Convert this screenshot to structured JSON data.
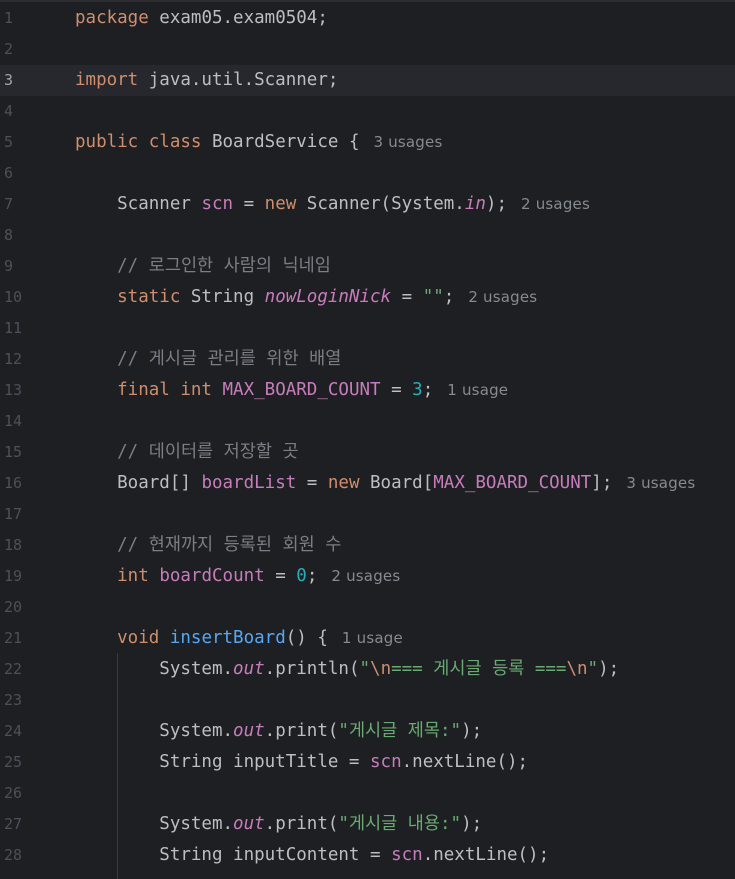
{
  "editor": {
    "current_line": 3,
    "lines": [
      {
        "n": "1",
        "tokens": [
          [
            "kw",
            "package"
          ],
          [
            "p",
            " exam05.exam0504;"
          ]
        ]
      },
      {
        "n": "2",
        "tokens": []
      },
      {
        "n": "3",
        "tokens": [
          [
            "kw",
            "import"
          ],
          [
            "p",
            " java.util.Scanner;"
          ]
        ]
      },
      {
        "n": "4",
        "tokens": []
      },
      {
        "n": "5",
        "tokens": [
          [
            "kw",
            "public class"
          ],
          [
            "p",
            " BoardService {"
          ],
          [
            "hint",
            "3 usages"
          ]
        ]
      },
      {
        "n": "6",
        "tokens": []
      },
      {
        "n": "7",
        "tokens": [
          [
            "p",
            "    Scanner "
          ],
          [
            "fld",
            "scn"
          ],
          [
            "p",
            " = "
          ],
          [
            "kw",
            "new"
          ],
          [
            "p",
            " Scanner(System."
          ],
          [
            "sfi",
            "in"
          ],
          [
            "p",
            ");"
          ],
          [
            "hint",
            "2 usages"
          ]
        ]
      },
      {
        "n": "8",
        "tokens": []
      },
      {
        "n": "9",
        "tokens": [
          [
            "cmt",
            "    // 로그인한 사람의 닉네임"
          ]
        ]
      },
      {
        "n": "10",
        "tokens": [
          [
            "kw",
            "    static"
          ],
          [
            "p",
            " String "
          ],
          [
            "sfi",
            "nowLoginNick"
          ],
          [
            "p",
            " = "
          ],
          [
            "str",
            "\"\""
          ],
          [
            "p",
            ";"
          ],
          [
            "hint",
            "2 usages"
          ]
        ]
      },
      {
        "n": "11",
        "tokens": []
      },
      {
        "n": "12",
        "tokens": [
          [
            "cmt",
            "    // 게시글 관리를 위한 배열"
          ]
        ]
      },
      {
        "n": "13",
        "tokens": [
          [
            "kw",
            "    final int"
          ],
          [
            "p",
            " "
          ],
          [
            "fld",
            "MAX_BOARD_COUNT"
          ],
          [
            "p",
            " = "
          ],
          [
            "num",
            "3"
          ],
          [
            "p",
            ";"
          ],
          [
            "hint",
            "1 usage"
          ]
        ]
      },
      {
        "n": "14",
        "tokens": []
      },
      {
        "n": "15",
        "tokens": [
          [
            "cmt",
            "    // 데이터를 저장할 곳"
          ]
        ]
      },
      {
        "n": "16",
        "tokens": [
          [
            "p",
            "    Board[] "
          ],
          [
            "fld",
            "boardList"
          ],
          [
            "p",
            " = "
          ],
          [
            "kw",
            "new"
          ],
          [
            "p",
            " Board["
          ],
          [
            "fld",
            "MAX_BOARD_COUNT"
          ],
          [
            "p",
            "];"
          ],
          [
            "hint",
            "3 usages"
          ]
        ]
      },
      {
        "n": "17",
        "tokens": []
      },
      {
        "n": "18",
        "tokens": [
          [
            "cmt",
            "    // 현재까지 등록된 회원 수"
          ]
        ]
      },
      {
        "n": "19",
        "tokens": [
          [
            "kw",
            "    int"
          ],
          [
            "p",
            " "
          ],
          [
            "fld",
            "boardCount"
          ],
          [
            "p",
            " = "
          ],
          [
            "num",
            "0"
          ],
          [
            "p",
            ";"
          ],
          [
            "hint",
            "2 usages"
          ]
        ]
      },
      {
        "n": "20",
        "tokens": []
      },
      {
        "n": "21",
        "tokens": [
          [
            "kw",
            "    void"
          ],
          [
            "p",
            " "
          ],
          [
            "mdecl",
            "insertBoard"
          ],
          [
            "p",
            "() {"
          ],
          [
            "hint",
            "1 usage"
          ]
        ]
      },
      {
        "n": "22",
        "tokens": [
          [
            "p",
            "        System."
          ],
          [
            "sfi",
            "out"
          ],
          [
            "p",
            ".println("
          ],
          [
            "str",
            "\""
          ],
          [
            "esc",
            "\\n"
          ],
          [
            "str",
            "=== 게시글 등록 ==="
          ],
          [
            "esc",
            "\\n"
          ],
          [
            "str",
            "\""
          ],
          [
            "p",
            ");"
          ]
        ]
      },
      {
        "n": "23",
        "tokens": []
      },
      {
        "n": "24",
        "tokens": [
          [
            "p",
            "        System."
          ],
          [
            "sfi",
            "out"
          ],
          [
            "p",
            ".print("
          ],
          [
            "str",
            "\"게시글 제목:\""
          ],
          [
            "p",
            ");"
          ]
        ]
      },
      {
        "n": "25",
        "tokens": [
          [
            "p",
            "        String inputTitle = "
          ],
          [
            "fld",
            "scn"
          ],
          [
            "p",
            ".nextLine();"
          ]
        ]
      },
      {
        "n": "26",
        "tokens": []
      },
      {
        "n": "27",
        "tokens": [
          [
            "p",
            "        System."
          ],
          [
            "sfi",
            "out"
          ],
          [
            "p",
            ".print("
          ],
          [
            "str",
            "\"게시글 내용:\""
          ],
          [
            "p",
            ");"
          ]
        ]
      },
      {
        "n": "28",
        "tokens": [
          [
            "p",
            "        String inputContent = "
          ],
          [
            "fld",
            "scn"
          ],
          [
            "p",
            ".nextLine();"
          ]
        ]
      }
    ]
  }
}
